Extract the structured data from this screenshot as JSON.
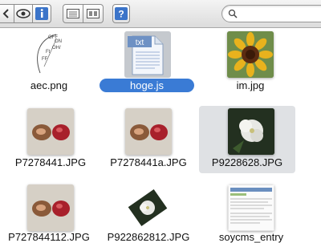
{
  "toolbar": {
    "buttons": [
      "back-icon",
      "quicklook-icon",
      "info-icon",
      "view-icon",
      "cover-icon",
      "help-icon"
    ],
    "search": {
      "placeholder": "",
      "value": ""
    }
  },
  "files": [
    {
      "name": "aec.png",
      "icon": "dial-diagram-thumbnail",
      "selected": false,
      "dial_labels": [
        "OFF",
        "ON",
        "OH/",
        "Ft",
        "FF"
      ]
    },
    {
      "name": "hoge.js",
      "icon": "txt-document-icon",
      "icon_text": "txt",
      "selected": true
    },
    {
      "name": "im.jpg",
      "icon": "sunflower-thumbnail",
      "selected": false
    },
    {
      "name": "P7278441.JPG",
      "icon": "fruit-photo-thumbnail",
      "selected": false
    },
    {
      "name": "P7278441a.JPG",
      "icon": "fruit-photo-thumbnail",
      "selected": false
    },
    {
      "name": "P9228628.JPG",
      "icon": "flower-photo-thumbnail",
      "selected": false,
      "highlighted": true
    },
    {
      "name": "P727844112.JPG",
      "icon": "fruit-photo-thumbnail",
      "selected": false
    },
    {
      "name": "P922862812.JPG",
      "icon": "rotated-flower-thumbnail",
      "selected": false
    },
    {
      "name": "soycms_entry",
      "icon": "webpage-thumbnail",
      "selected": false
    }
  ],
  "colors": {
    "selection": "#3a7bd5",
    "highlight": "#dfe1e4",
    "toolbar": "#e4e4e4"
  }
}
